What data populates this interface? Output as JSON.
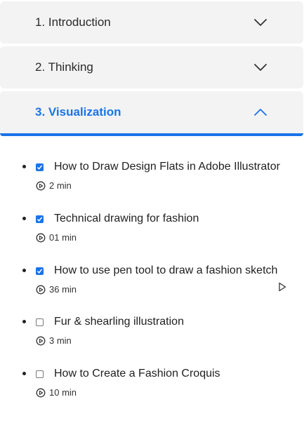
{
  "sections": [
    {
      "label": "1. Introduction",
      "expanded": false
    },
    {
      "label": "2. Thinking",
      "expanded": false
    },
    {
      "label": "3. Visualization",
      "expanded": true
    }
  ],
  "lessons": [
    {
      "title": "How to Draw Design Flats in Adobe Illustrator",
      "duration": "2 min",
      "completed": true
    },
    {
      "title": "Technical drawing for fashion",
      "duration": "01 min",
      "completed": true
    },
    {
      "title": "How to use pen tool to draw a fashion sketch",
      "duration": "36 min",
      "completed": true
    },
    {
      "title": "Fur & shearling illustration",
      "duration": "3 min",
      "completed": false
    },
    {
      "title": "How to Create a Fashion Croquis",
      "duration": "10 min",
      "completed": false
    }
  ],
  "colors": {
    "accent": "#1a73e8",
    "section_bg": "#f3f3f3"
  },
  "icons": {
    "expand": "chevron-down-icon",
    "collapse": "chevron-up-icon",
    "duration": "play-circle-icon",
    "resume": "play-triangle-icon"
  }
}
